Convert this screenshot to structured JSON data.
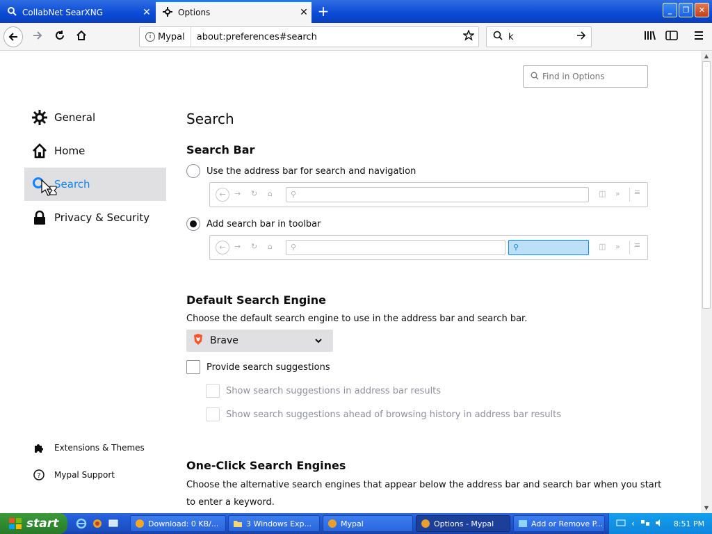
{
  "window": {
    "tabs": [
      {
        "title": "CollabNet SearXNG",
        "active": false
      },
      {
        "title": "Options",
        "active": true
      }
    ],
    "new_tab": "+",
    "controls": {
      "minimize": "_",
      "restore": "❐",
      "close": "✕"
    }
  },
  "navbar": {
    "identity_label": "Mypal",
    "url": "about:preferences#search",
    "search_query": "k"
  },
  "prefs": {
    "find_placeholder": "Find in Options",
    "categories": [
      {
        "label": "General",
        "icon": "gear-icon"
      },
      {
        "label": "Home",
        "icon": "home-icon"
      },
      {
        "label": "Search",
        "icon": "search-icon",
        "selected": true
      },
      {
        "label": "Privacy & Security",
        "icon": "lock-icon"
      }
    ],
    "footer_links": [
      {
        "label": "Extensions & Themes",
        "icon": "puzzle-icon"
      },
      {
        "label": "Mypal Support",
        "icon": "help-icon"
      }
    ],
    "page_title": "Search",
    "search_bar": {
      "heading": "Search Bar",
      "option_address": "Use the address bar for search and navigation",
      "option_toolbar": "Add search bar in toolbar",
      "selected": "toolbar"
    },
    "default_engine": {
      "heading": "Default Search Engine",
      "description": "Choose the default search engine to use in the address bar and search bar.",
      "engine": "Brave",
      "provide_suggestions": "Provide search suggestions",
      "suggest_address_bar": "Show search suggestions in address bar results",
      "suggest_ahead_history": "Show search suggestions ahead of browsing history in address bar results"
    },
    "one_click": {
      "heading": "One-Click Search Engines",
      "description_line1": "Choose the alternative search engines that appear below the address bar and search bar when you start",
      "description_line2": "to enter a keyword."
    }
  },
  "taskbar": {
    "start_label": "start",
    "items": [
      {
        "label": "Download: 0 KB/...",
        "active": false
      },
      {
        "label": "3 Windows Exp...",
        "active": false
      },
      {
        "label": "Mypal",
        "active": false
      },
      {
        "label": "Options - Mypal",
        "active": true
      },
      {
        "label": "Add or Remove P...",
        "active": false
      }
    ],
    "clock": "8:51 PM"
  },
  "colors": {
    "accent": "#0a84ff",
    "xp_blue": "#245edb",
    "start_green": "#3c9a3c"
  }
}
